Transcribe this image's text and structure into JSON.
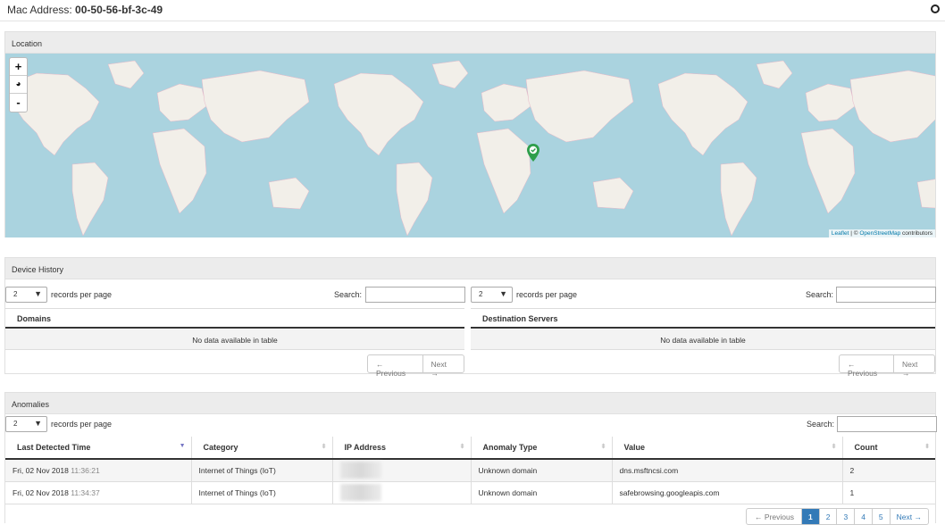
{
  "header": {
    "label": "Mac Address:",
    "value": "00-50-56-bf-3c-49"
  },
  "location": {
    "title": "Location",
    "zoom_in": "+",
    "zoom_out": "-",
    "attribution": {
      "leaflet": "Leaflet",
      "sep": " | © ",
      "osm": "OpenStreetMap",
      "suffix": " contributors"
    }
  },
  "history": {
    "title": "Device History",
    "left": {
      "length_value": "2",
      "length_text": "records per page",
      "search_label": "Search:",
      "column": "Domains",
      "empty": "No data available in table",
      "prev": "← Previous",
      "next": "Next →"
    },
    "right": {
      "length_value": "2",
      "length_text": "records per page",
      "search_label": "Search:",
      "column": "Destination Servers",
      "empty": "No data available in table",
      "prev": "← Previous",
      "next": "Next →"
    }
  },
  "anomalies": {
    "title": "Anomalies",
    "length_value": "2",
    "length_text": "records per page",
    "search_label": "Search:",
    "columns": [
      "Last Detected Time",
      "Category",
      "IP Address",
      "Anomaly Type",
      "Value",
      "Count"
    ],
    "rows": [
      {
        "date": "Fri, 02 Nov 2018",
        "time": "11:36:21",
        "category": "Internet of Things (IoT)",
        "type": "Unknown domain",
        "value": "dns.msftncsi.com",
        "count": "2"
      },
      {
        "date": "Fri, 02 Nov 2018",
        "time": "11:34:37",
        "category": "Internet of Things (IoT)",
        "type": "Unknown domain",
        "value": "safebrowsing.googleapis.com",
        "count": "1"
      }
    ],
    "pagination": {
      "prev": "← Previous",
      "pages": [
        "1",
        "2",
        "3",
        "4",
        "5"
      ],
      "current": "1",
      "next": "Next →"
    }
  },
  "colors": {
    "ocean": "#aad3df",
    "land": "#f2efe9",
    "marker": "#2e9e4b",
    "link": "#337ab7"
  }
}
